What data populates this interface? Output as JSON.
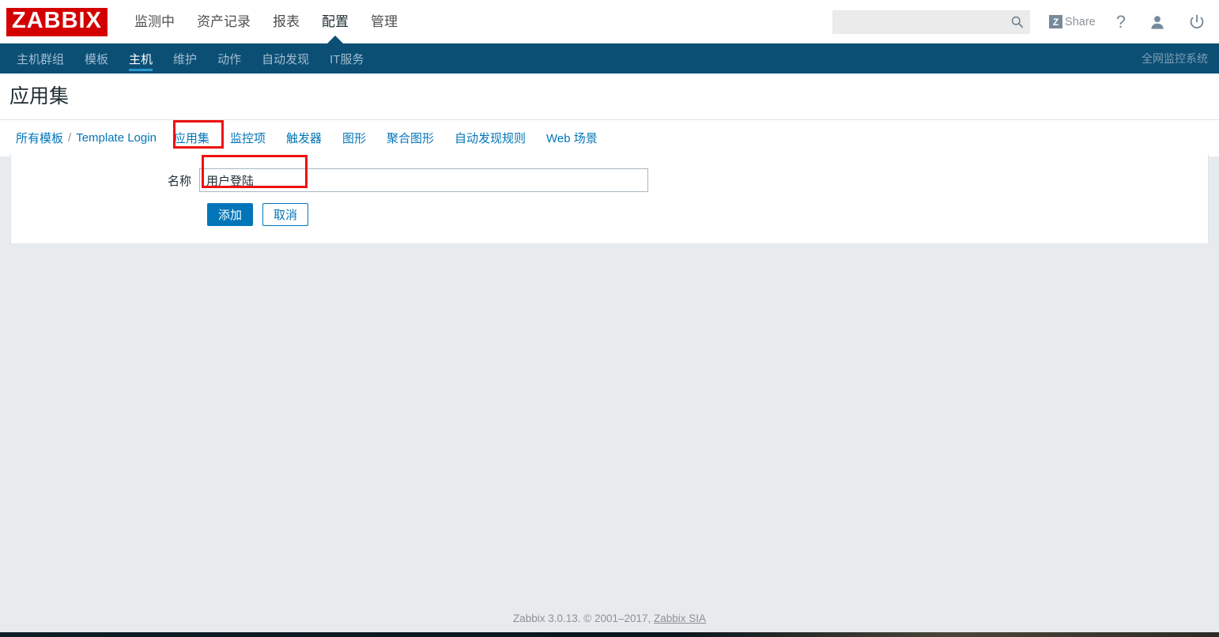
{
  "brand": {
    "logo_text": "ZABBIX",
    "logo_color": "#d40000"
  },
  "header": {
    "menu": [
      {
        "label": "监测中",
        "selected": false
      },
      {
        "label": "资产记录",
        "selected": false
      },
      {
        "label": "报表",
        "selected": false
      },
      {
        "label": "配置",
        "selected": true
      },
      {
        "label": "管理",
        "selected": false
      }
    ],
    "search": {
      "value": "",
      "placeholder": "",
      "icon": "search-icon"
    },
    "share": {
      "label": "Share",
      "badge": "Z",
      "icon": "zabbix-share-icon"
    },
    "help": {
      "label": "?",
      "icon": "help-icon"
    },
    "user": {
      "icon": "user-icon"
    },
    "power": {
      "icon": "power-icon"
    }
  },
  "subnav": {
    "items": [
      {
        "label": "主机群组",
        "selected": false
      },
      {
        "label": "模板",
        "selected": false
      },
      {
        "label": "主机",
        "selected": true
      },
      {
        "label": "维护",
        "selected": false
      },
      {
        "label": "动作",
        "selected": false
      },
      {
        "label": "自动发现",
        "selected": false
      },
      {
        "label": "IT服务",
        "selected": false
      }
    ],
    "right_label": "全网监控系统",
    "accent_color": "#2a98d4",
    "background_color": "#0b4f75"
  },
  "page": {
    "title": "应用集"
  },
  "breadcrumb": {
    "root": "所有模板",
    "separator": "/",
    "current": "Template Login"
  },
  "tabs": [
    {
      "label": "应用集",
      "highlighted": true
    },
    {
      "label": "监控项",
      "highlighted": false
    },
    {
      "label": "触发器",
      "highlighted": false
    },
    {
      "label": "图形",
      "highlighted": false
    },
    {
      "label": "聚合图形",
      "highlighted": false
    },
    {
      "label": "自动发现规则",
      "highlighted": false
    },
    {
      "label": "Web 场景",
      "highlighted": false
    }
  ],
  "form": {
    "name_label": "名称",
    "name_value": "用户登陆",
    "name_placeholder": "",
    "submit_label": "添加",
    "cancel_label": "取消"
  },
  "annotations": {
    "tab_box_color": "#ee1111",
    "name_box_color": "#ee1111"
  },
  "footer": {
    "text": "Zabbix 3.0.13. © 2001–2017,",
    "link": "Zabbix SIA"
  }
}
